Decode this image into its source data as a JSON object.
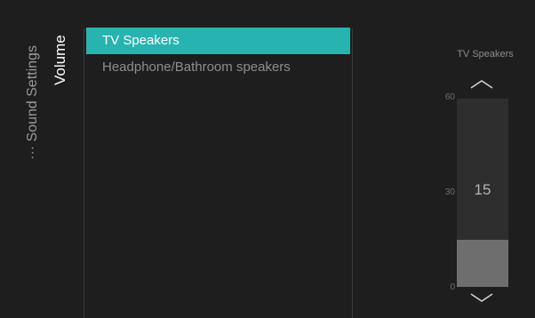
{
  "breadcrumb": {
    "parent_label": "··· Sound Settings",
    "current_label": "Volume"
  },
  "menu": {
    "items": [
      {
        "label": "TV Speakers",
        "selected": true
      },
      {
        "label": "Headphone/Bathroom speakers",
        "selected": false
      }
    ]
  },
  "volume_panel": {
    "title": "TV Speakers",
    "value": "15",
    "scale_max": "60",
    "scale_mid": "30",
    "scale_min": "0",
    "level_fraction": 0.25
  },
  "colors": {
    "accent": "#27b3b0",
    "background": "#1e1e1e"
  },
  "icons": {
    "up": "chevron-up-icon",
    "down": "chevron-down-icon"
  }
}
